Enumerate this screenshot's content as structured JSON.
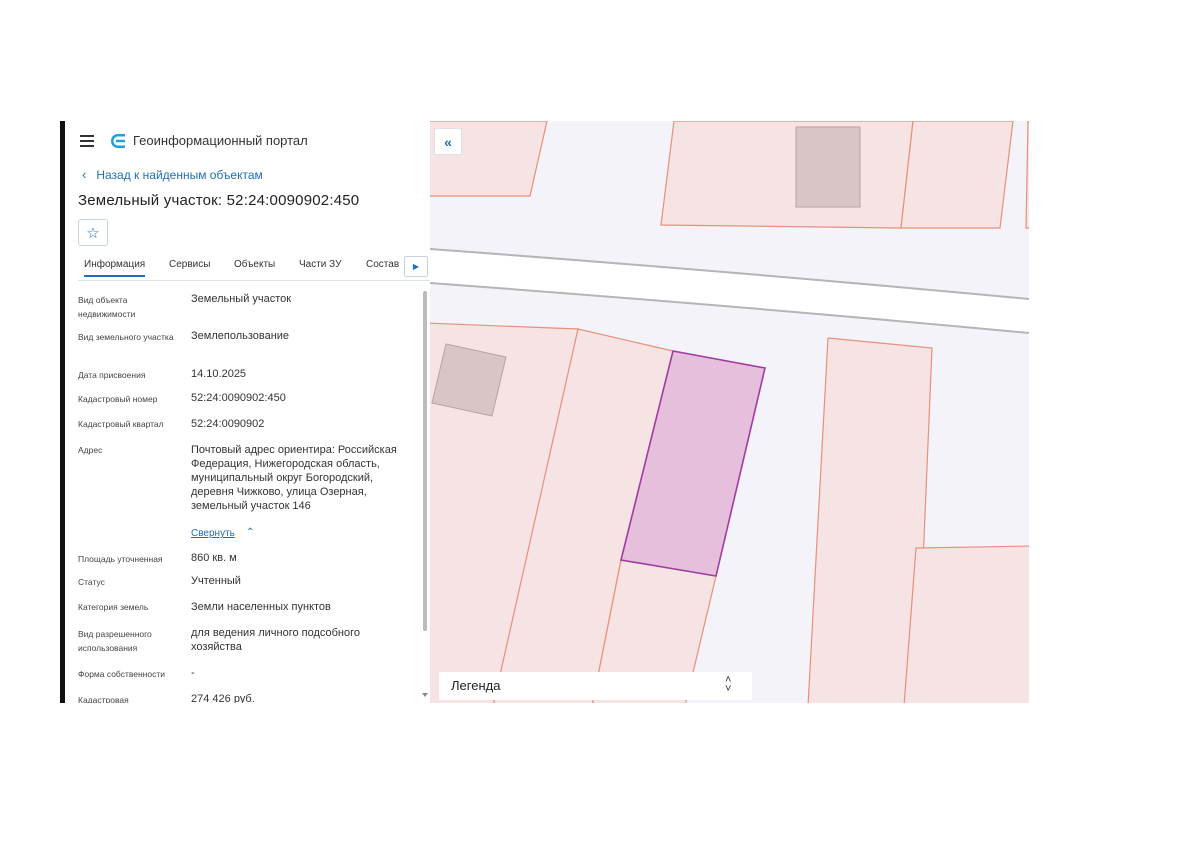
{
  "header": {
    "title": "Геоинформационный портал"
  },
  "nav": {
    "back_label": "Назад к найденным объектам"
  },
  "object": {
    "title": "Земельный участок: 52:24:0090902:450"
  },
  "tabs": [
    {
      "label": "Информация",
      "active": true
    },
    {
      "label": "Сервисы"
    },
    {
      "label": "Объекты"
    },
    {
      "label": "Части ЗУ"
    },
    {
      "label": "Состав"
    }
  ],
  "info": [
    {
      "label": "Вид объекта недвижимости",
      "value": "Земельный участок"
    },
    {
      "label": "Вид земельного участка",
      "value": "Землепользование"
    },
    {
      "label": "Дата присвоения",
      "value": "14.10.2025"
    },
    {
      "label": "Кадастровый номер",
      "value": "52:24:0090902:450"
    },
    {
      "label": "Кадастровый квартал",
      "value": "52:24:0090902"
    },
    {
      "label": "Адрес",
      "value": "Почтовый адрес ориентира: Российская Федерация, Нижегородская область, муниципальный округ Богородский, деревня Чижково, улица Озерная, земельный участок 146"
    },
    {
      "label": "Площадь уточненная",
      "value": "860 кв. м"
    },
    {
      "label": "Статус",
      "value": "Учтенный"
    },
    {
      "label": "Категория земель",
      "value": "Земли населенных пунктов"
    },
    {
      "label": "Вид разрешенного использования",
      "value": "для ведения личного подсобного хозяйства"
    },
    {
      "label": "Форма собственности",
      "value": "-"
    },
    {
      "label": "Кадастровая",
      "value": "274 426 руб."
    }
  ],
  "address_toggle": "Свернуть",
  "map": {
    "legend_label": "Легенда",
    "colors": {
      "parcel_fill": "#f6e3e3",
      "parcel_stroke": "#e7907a",
      "selected_fill": "#e5bfdc",
      "selected_stroke": "#a13ba3",
      "building_fill": "#d9c5c5",
      "road": "#ffffff",
      "background": "#f4f3fa"
    }
  },
  "icons": {
    "menu": "hamburger-icon",
    "logo": "portal-logo-icon",
    "back": "chevron-left-icon",
    "favorite": "star-icon",
    "tabs_scroll": "triangle-right-icon",
    "collapse": "double-chevron-left-icon",
    "address_toggle": "chevron-up-icon",
    "legend_toggle": "updown-chevron-icon"
  }
}
